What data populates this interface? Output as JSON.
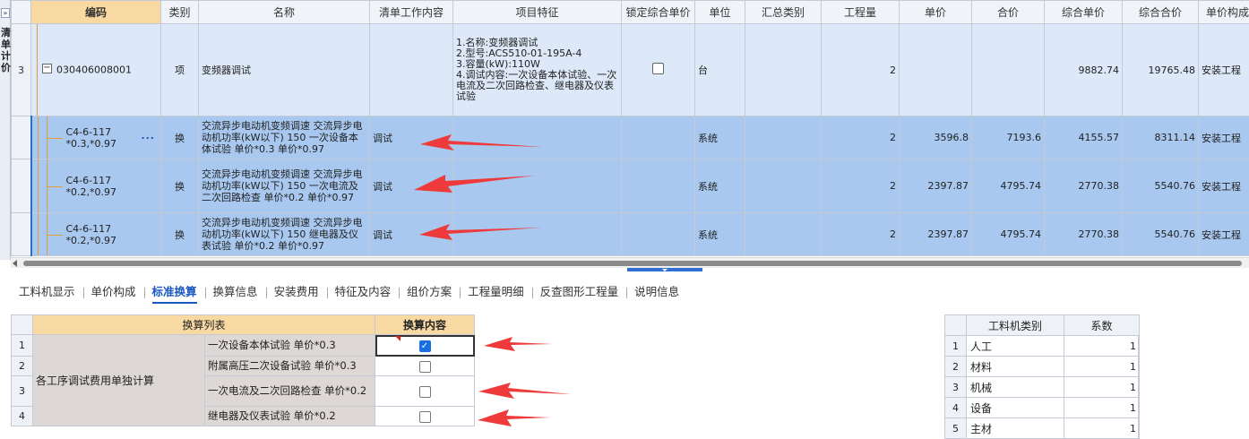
{
  "left_panel": {
    "expand_label": "»",
    "vertical_text": "清单计价"
  },
  "main_grid": {
    "headers": {
      "code": "编码",
      "category": "类别",
      "name": "名称",
      "work_content": "清单工作内容",
      "features": "项目特征",
      "lock_price": "锁定综合单价",
      "unit": "单位",
      "summary_category": "汇总类别",
      "quantity": "工程量",
      "unit_price": "单价",
      "total_price": "合价",
      "comp_unit_price": "综合单价",
      "comp_total_price": "综合合价",
      "price_file": "单价构成文件"
    },
    "parent_row": {
      "row_number": "3",
      "code": "030406008001",
      "category": "项",
      "name": "变频器调试",
      "features": "1.名称:变频器调试\n2.型号:ACS510-01-195A-4\n3.容量(kW):110W\n4.调试内容:一次设备本体试验、一次电流及二次回路检查、继电器及仪表试验",
      "unit": "台",
      "quantity": "2",
      "comp_unit_price": "9882.74",
      "comp_total_price": "19765.48",
      "price_file": "安装工程"
    },
    "child_rows": [
      {
        "code": "C4-6-117\n*0.3,*0.97",
        "category": "换",
        "name": "交流异步电动机变频调速 交流异步电动机功率(kW以下) 150  一次设备本体试验 单价*0.3  单价*0.97",
        "work_content": "调试",
        "unit": "系统",
        "quantity": "2",
        "unit_price": "3596.8",
        "total_price": "7193.6",
        "comp_unit_price": "4155.57",
        "comp_total_price": "8311.14",
        "price_file": "安装工程"
      },
      {
        "code": "C4-6-117\n*0.2,*0.97",
        "category": "换",
        "name": "交流异步电动机变频调速 交流异步电动机功率(kW以下) 150  一次电流及二次回路检查 单价*0.2  单价*0.97",
        "work_content": "调试",
        "unit": "系统",
        "quantity": "2",
        "unit_price": "2397.87",
        "total_price": "4795.74",
        "comp_unit_price": "2770.38",
        "comp_total_price": "5540.76",
        "price_file": "安装工程"
      },
      {
        "code": "C4-6-117\n*0.2,*0.97",
        "category": "换",
        "name": "交流异步电动机变频调速 交流异步电动机功率(kW以下) 150  继电器及仪表试验 单价*0.2  单价*0.97",
        "work_content": "调试",
        "unit": "系统",
        "quantity": "2",
        "unit_price": "2397.87",
        "total_price": "4795.74",
        "comp_unit_price": "2770.38",
        "comp_total_price": "5540.76",
        "price_file": "安装工程"
      }
    ],
    "more_icon": "ellipsis-icon"
  },
  "tabs": [
    {
      "label": "工料机显示"
    },
    {
      "label": "单价构成"
    },
    {
      "label": "标准换算",
      "active": true
    },
    {
      "label": "换算信息"
    },
    {
      "label": "安装费用"
    },
    {
      "label": "特征及内容"
    },
    {
      "label": "组价方案"
    },
    {
      "label": "工程量明细"
    },
    {
      "label": "反查图形工程量"
    },
    {
      "label": "说明信息"
    }
  ],
  "conversion": {
    "header_list": "换算列表",
    "header_content": "换算内容",
    "group_label": "各工序调试费用单独计算",
    "rows": [
      {
        "row_number": "1",
        "label": "一次设备本体试验 单价*0.3",
        "checked": true
      },
      {
        "row_number": "2",
        "label": "附属高压二次设备试验 单价*0.3",
        "checked": false
      },
      {
        "row_number": "3",
        "label": "一次电流及二次回路检查 单价*0.2",
        "checked": false
      },
      {
        "row_number": "4",
        "label": "继电器及仪表试验 单价*0.2",
        "checked": false
      }
    ]
  },
  "labor_types": {
    "header_type": "工料机类别",
    "header_coef": "系数",
    "rows": [
      {
        "row_number": "1",
        "type": "人工",
        "coef": "1"
      },
      {
        "row_number": "2",
        "type": "材料",
        "coef": "1"
      },
      {
        "row_number": "3",
        "type": "机械",
        "coef": "1"
      },
      {
        "row_number": "4",
        "type": "设备",
        "coef": "1"
      },
      {
        "row_number": "5",
        "type": "主材",
        "coef": "1"
      }
    ]
  },
  "colors": {
    "header_highlight": "#f9d9a2",
    "child_row_bg": "#a8c8f0",
    "parent_row_bg": "#dde8f8",
    "active_tab": "#1a58c0",
    "annotation_arrow": "#ee3a3a",
    "checkbox_checked": "#1a6fe0"
  }
}
